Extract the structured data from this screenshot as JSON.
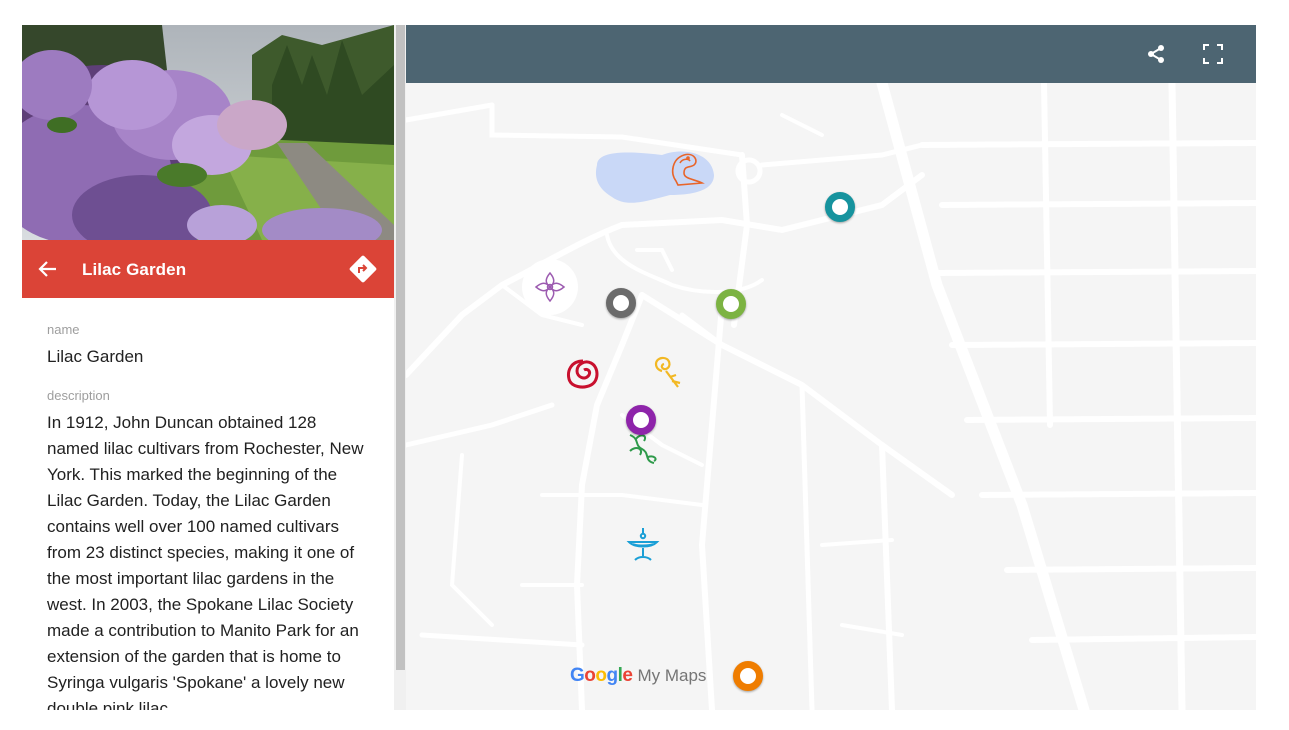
{
  "place": {
    "title": "Lilac Garden",
    "name_label": "name",
    "name_value": "Lilac Garden",
    "description_label": "description",
    "description": "In 1912, John Duncan obtained 128 named lilac cultivars from Rochester, New York. This marked the beginning of the Lilac Garden. Today, the Lilac Garden contains well over 100 named cultivars from 23 distinct species, making it one of the most important lilac gardens in the west. In 2003, the Spokane Lilac Society made a contribution to Manito Park for an extension of the garden that is home to Syringa vulgaris 'Spokane' a lovely new double pink lilac."
  },
  "toolbar": {
    "share_icon": "share-icon",
    "fullscreen_icon": "fullscreen-icon"
  },
  "branding": {
    "google": "Google",
    "mymaps": "My Maps"
  },
  "colors": {
    "topbar": "#4d6572",
    "titlebar": "#db4437",
    "map_background": "#f5f5f5",
    "pond": "#c9d8f7",
    "marker_teal": "#16939e",
    "marker_gray": "#6b6b6b",
    "marker_green": "#7cb342",
    "marker_purple": "#8e24aa",
    "marker_orange": "#ef7d00",
    "icon_rose": "#c8102e",
    "icon_yellow": "#f2b824",
    "icon_lilac": "#9c5bb0",
    "icon_orange": "#e8652a",
    "icon_fountain": "#1a9fd6",
    "icon_vine": "#2e9a4a"
  },
  "markers": [
    {
      "name": "teal-marker"
    },
    {
      "name": "gray-marker"
    },
    {
      "name": "green-marker"
    },
    {
      "name": "purple-marker"
    },
    {
      "name": "orange-marker"
    }
  ]
}
